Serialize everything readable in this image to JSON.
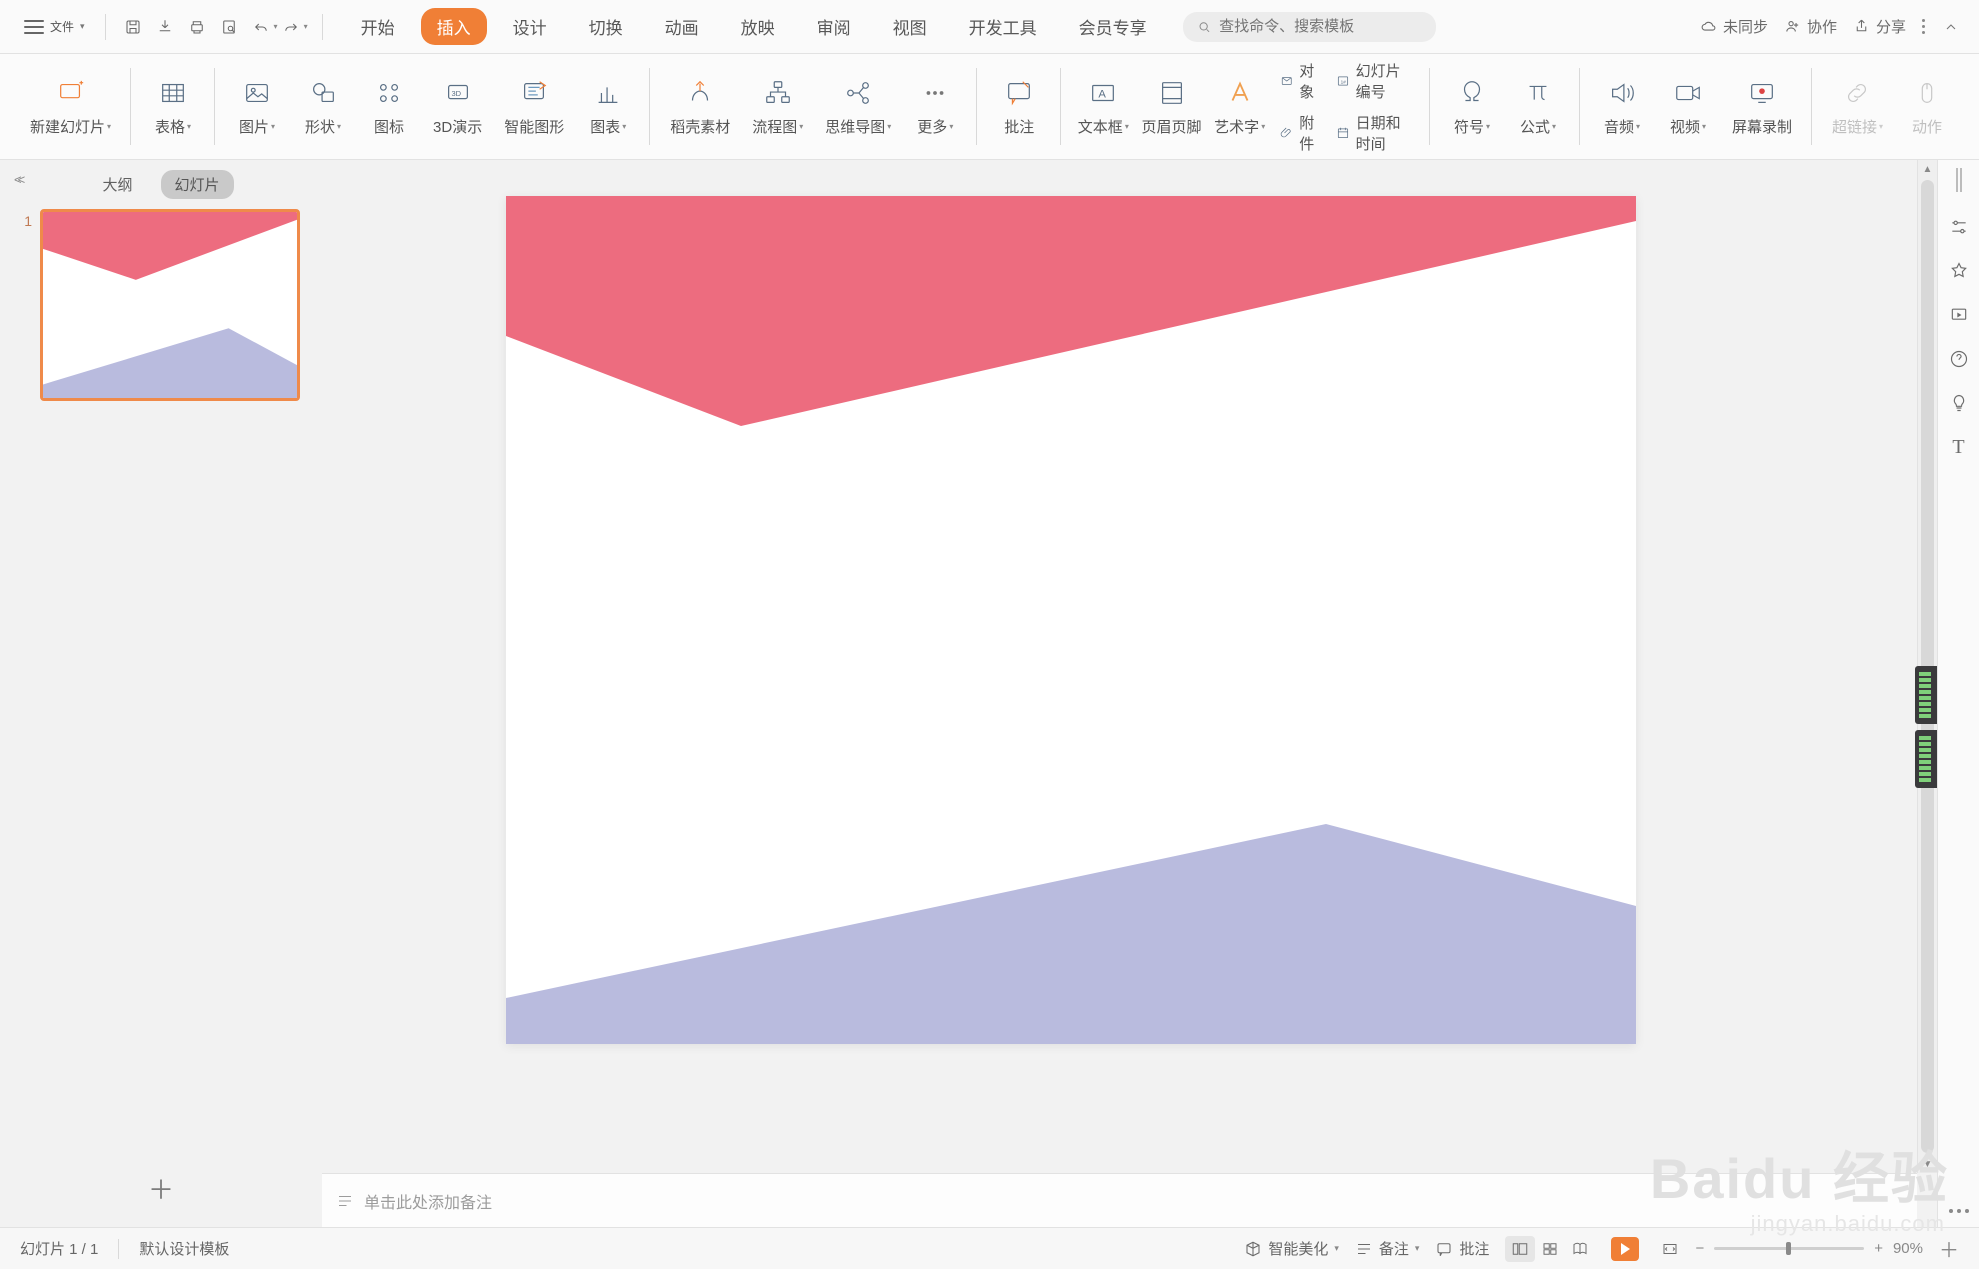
{
  "menubar": {
    "file_label": "文件",
    "tabs": [
      "开始",
      "插入",
      "设计",
      "切换",
      "动画",
      "放映",
      "审阅",
      "视图",
      "开发工具",
      "会员专享"
    ],
    "active_tab_index": 1,
    "search_placeholder": "查找命令、搜索模板",
    "sync_label": "未同步",
    "collab_label": "协作",
    "share_label": "分享"
  },
  "ribbon": {
    "new_slide": "新建幻灯片",
    "table": "表格",
    "picture": "图片",
    "shape": "形状",
    "icon": "图标",
    "threeD": "3D演示",
    "smartart": "智能图形",
    "chart": "图表",
    "docer": "稻壳素材",
    "flowchart": "流程图",
    "mindmap": "思维导图",
    "more": "更多",
    "comment": "批注",
    "textbox": "文本框",
    "headerfooter": "页眉页脚",
    "wordart": "艺术字",
    "object": "对象",
    "slidenum": "幻灯片编号",
    "attach": "附件",
    "datetime": "日期和时间",
    "symbol": "符号",
    "equation": "公式",
    "audio": "音频",
    "video": "视频",
    "screenrec": "屏幕录制",
    "hyperlink": "超链接",
    "action": "动作"
  },
  "thumbs": {
    "outline_label": "大纲",
    "slides_label": "幻灯片",
    "slide_numbers": [
      "1"
    ]
  },
  "notes": {
    "placeholder": "单击此处添加备注"
  },
  "status": {
    "slide_counter": "幻灯片 1 / 1",
    "template": "默认设计模板",
    "smart_beauty": "智能美化",
    "notes_btn": "备注",
    "comments_btn": "批注",
    "zoom_value": "90%"
  },
  "watermark": {
    "brand": "Baidu 经验",
    "url": "jingyan.baidu.com"
  }
}
